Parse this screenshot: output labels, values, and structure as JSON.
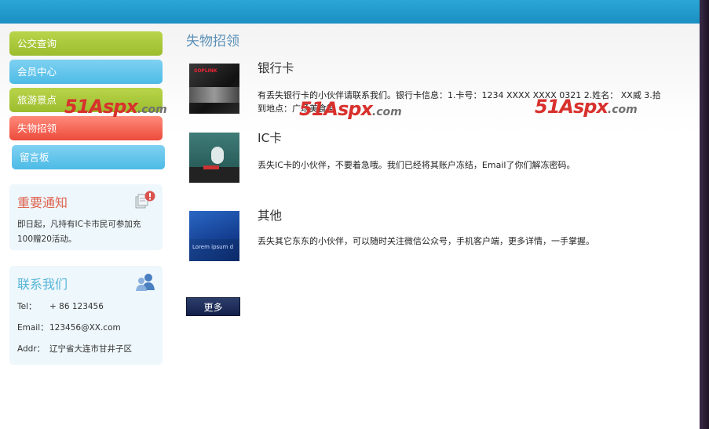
{
  "nav": {
    "items": [
      {
        "label": "公交查询"
      },
      {
        "label": "会员中心"
      },
      {
        "label": "旅游景点"
      },
      {
        "label": "失物招领"
      },
      {
        "label": "留言板"
      }
    ]
  },
  "notice": {
    "title": "重要通知",
    "text": "即日起，凡持有IC卡市民可参加充100赠20活动。"
  },
  "contact": {
    "title": "联系我们",
    "tel_label": "Tel：",
    "tel_value": "+ 86 123456",
    "email_label": "Email：",
    "email_value": "123456@XX.com",
    "addr_label": "Addr：",
    "addr_value": "辽宁省大连市甘井子区"
  },
  "main": {
    "heading": "失物招领",
    "items": [
      {
        "title": "银行卡",
        "desc": "有丢失银行卡的小伙伴请联系我们。银行卡信息：1.卡号：1234 XXXX XXXX 0321 2.姓名： XX威 3.拾到地点：广场美食街"
      },
      {
        "title": "IC卡",
        "desc": "丢失IC卡的小伙伴，不要着急哦。我们已经将其账户冻结，Email了你们解冻密码。"
      },
      {
        "title": "其他",
        "desc": "丢失其它东东的小伙伴，可以随时关注微信公众号，手机客户端，更多详情，一手掌握。"
      }
    ],
    "more_label": "更多"
  },
  "thumbs": {
    "t1_logo": "SOPLINK",
    "t3_text": "Lorem ipsum d"
  },
  "watermark": {
    "brand": "51Aspx",
    "suffix": ".com"
  }
}
